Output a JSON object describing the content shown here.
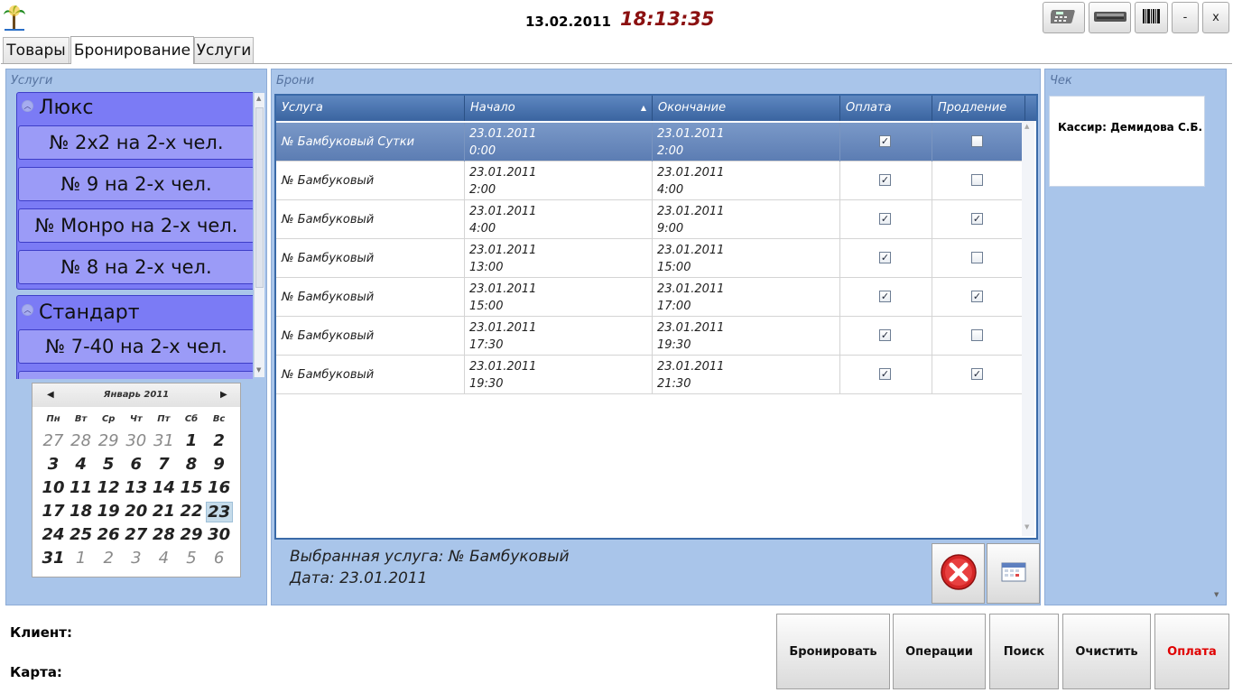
{
  "header": {
    "date": "13.02.2011",
    "time": "18:13:35",
    "buttons": [
      "calculator-icon",
      "scanner-icon",
      "barcode-icon"
    ],
    "minimize_label": "-",
    "close_label": "x"
  },
  "tabs": [
    {
      "label": "Товары",
      "active": false
    },
    {
      "label": "Бронирование",
      "active": true
    },
    {
      "label": "Услуги",
      "active": false
    }
  ],
  "services_panel": {
    "title": "Услуги",
    "groups": [
      {
        "title": "Люкс",
        "items": [
          "№ 2x2 на 2-х чел.",
          "№ 9 на 2-х чел.",
          "№ Монро на 2-х чел.",
          "№ 8 на 2-х чел."
        ]
      },
      {
        "title": "Стандарт",
        "items": [
          "№ 7-40 на 2-х чел."
        ]
      }
    ]
  },
  "calendar": {
    "month": "Январь 2011",
    "weekdays": [
      "Пн",
      "Вт",
      "Ср",
      "Чт",
      "Пт",
      "Сб",
      "Вс"
    ],
    "weeks": [
      [
        "27",
        "28",
        "29",
        "30",
        "31",
        "1",
        "2"
      ],
      [
        "3",
        "4",
        "5",
        "6",
        "7",
        "8",
        "9"
      ],
      [
        "10",
        "11",
        "12",
        "13",
        "14",
        "15",
        "16"
      ],
      [
        "17",
        "18",
        "19",
        "20",
        "21",
        "22",
        "23"
      ],
      [
        "24",
        "25",
        "26",
        "27",
        "28",
        "29",
        "30"
      ],
      [
        "31",
        "1",
        "2",
        "3",
        "4",
        "5",
        "6"
      ]
    ],
    "selected": "23"
  },
  "bookings_panel": {
    "title": "Брони",
    "columns": [
      "Услуга",
      "Начало",
      "Окончание",
      "Оплата",
      "Продление"
    ],
    "rows": [
      {
        "service": "№ Бамбуковый Сутки",
        "start_date": "23.01.2011",
        "start_time": "0:00",
        "end_date": "23.01.2011",
        "end_time": "2:00",
        "paid": true,
        "extended": false,
        "selected": true
      },
      {
        "service": "№ Бамбуковый",
        "start_date": "23.01.2011",
        "start_time": "2:00",
        "end_date": "23.01.2011",
        "end_time": "4:00",
        "paid": true,
        "extended": false,
        "selected": false
      },
      {
        "service": "№ Бамбуковый",
        "start_date": "23.01.2011",
        "start_time": "4:00",
        "end_date": "23.01.2011",
        "end_time": "9:00",
        "paid": true,
        "extended": true,
        "selected": false
      },
      {
        "service": "№ Бамбуковый",
        "start_date": "23.01.2011",
        "start_time": "13:00",
        "end_date": "23.01.2011",
        "end_time": "15:00",
        "paid": true,
        "extended": false,
        "selected": false
      },
      {
        "service": "№ Бамбуковый",
        "start_date": "23.01.2011",
        "start_time": "15:00",
        "end_date": "23.01.2011",
        "end_time": "17:00",
        "paid": true,
        "extended": true,
        "selected": false
      },
      {
        "service": "№ Бамбуковый",
        "start_date": "23.01.2011",
        "start_time": "17:30",
        "end_date": "23.01.2011",
        "end_time": "19:30",
        "paid": true,
        "extended": false,
        "selected": false
      },
      {
        "service": "№ Бамбуковый",
        "start_date": "23.01.2011",
        "start_time": "19:30",
        "end_date": "23.01.2011",
        "end_time": "21:30",
        "paid": true,
        "extended": true,
        "selected": false
      }
    ],
    "selected_service": "Выбранная услуга: № Бамбуковый",
    "selected_date": "Дата: 23.01.2011"
  },
  "receipt_panel": {
    "title": "Чек",
    "cashier": "Кассир: Демидова С.Б."
  },
  "footer": {
    "client_label": "Клиент:",
    "card_label": "Карта:",
    "actions": [
      "Бронировать",
      "Операции",
      "Поиск",
      "Очистить",
      "Оплата"
    ],
    "pay_color": "#e00000"
  }
}
